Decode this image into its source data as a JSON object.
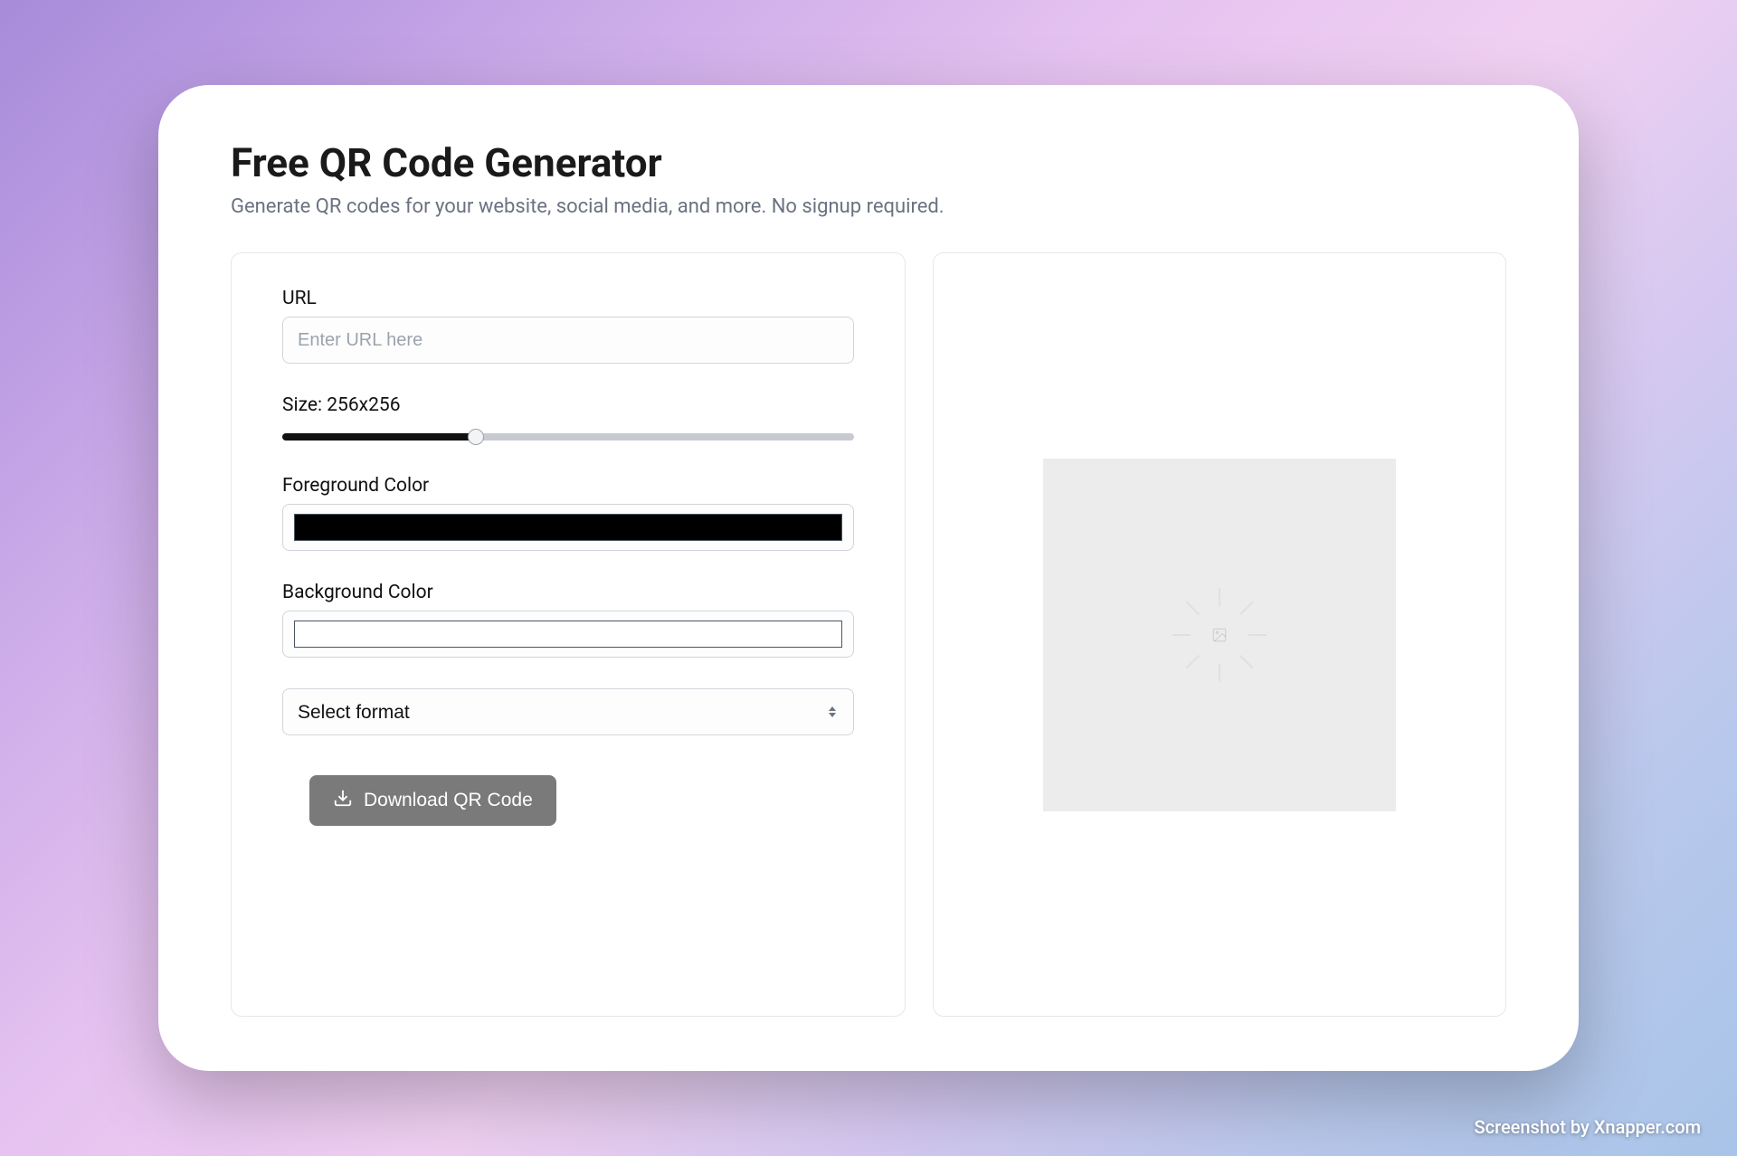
{
  "header": {
    "title": "Free QR Code Generator",
    "subtitle": "Generate QR codes for your website, social media, and more. No signup required."
  },
  "form": {
    "url": {
      "label": "URL",
      "placeholder": "Enter URL here",
      "value": ""
    },
    "size": {
      "label": "Size: 256x256",
      "value": 256,
      "min": 64,
      "max": 640,
      "fill_percent": 34
    },
    "foreground": {
      "label": "Foreground Color",
      "value": "#000000"
    },
    "background": {
      "label": "Background Color",
      "value": "#ffffff"
    },
    "format": {
      "placeholder": "Select format"
    },
    "download_label": "Download QR Code"
  },
  "watermark": "Screenshot by Xnapper.com"
}
